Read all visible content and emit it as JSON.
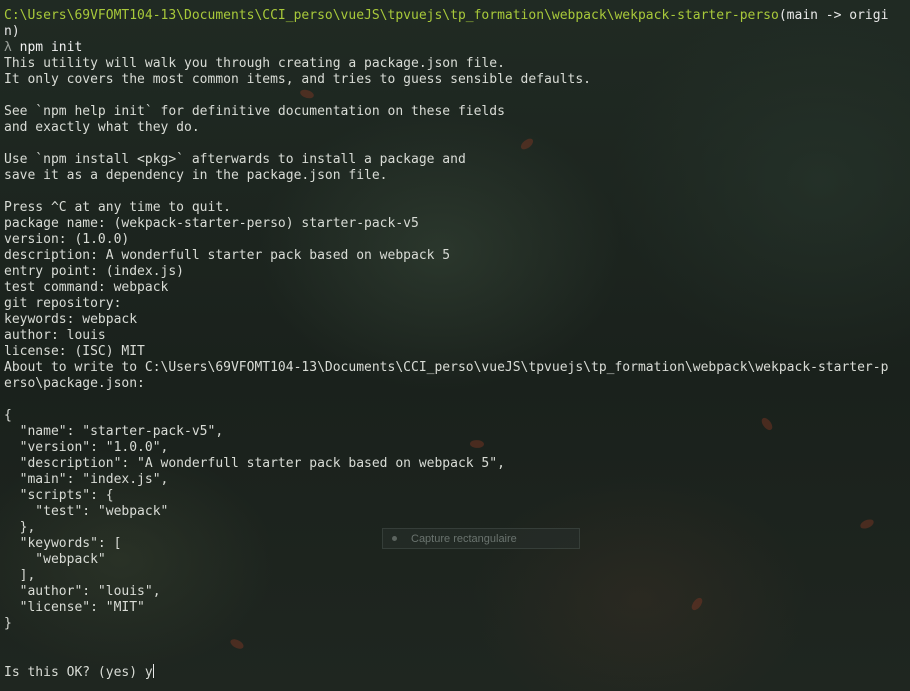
{
  "terminal": {
    "prompt_path": "C:\\Users\\69VFOMT104-13\\Documents\\CCI_perso\\vueJS\\tpvuejs\\tp_formation\\webpack\\wekpack-starter-perso",
    "prompt_branch": "(main -> origi",
    "prompt_wrap": "n)",
    "prompt_symbol": "λ",
    "command": "npm init",
    "lines": [
      "This utility will walk you through creating a package.json file.",
      "It only covers the most common items, and tries to guess sensible defaults.",
      "",
      "See `npm help init` for definitive documentation on these fields",
      "and exactly what they do.",
      "",
      "Use `npm install <pkg>` afterwards to install a package and",
      "save it as a dependency in the package.json file.",
      "",
      "Press ^C at any time to quit.",
      "package name: (wekpack-starter-perso) starter-pack-v5",
      "version: (1.0.0)",
      "description: A wonderfull starter pack based on webpack 5",
      "entry point: (index.js)",
      "test command: webpack",
      "git repository:",
      "keywords: webpack",
      "author: louis",
      "license: (ISC) MIT",
      "About to write to C:\\Users\\69VFOMT104-13\\Documents\\CCI_perso\\vueJS\\tpvuejs\\tp_formation\\webpack\\wekpack-starter-p",
      "erso\\package.json:",
      "",
      "{",
      "  \"name\": \"starter-pack-v5\",",
      "  \"version\": \"1.0.0\",",
      "  \"description\": \"A wonderfull starter pack based on webpack 5\",",
      "  \"main\": \"index.js\",",
      "  \"scripts\": {",
      "    \"test\": \"webpack\"",
      "  },",
      "  \"keywords\": [",
      "    \"webpack\"",
      "  ],",
      "  \"author\": \"louis\",",
      "  \"license\": \"MIT\"",
      "}",
      "",
      ""
    ],
    "final_prompt": "Is this OK? (yes) y"
  },
  "overlay": {
    "label": "Capture rectangulaire"
  }
}
